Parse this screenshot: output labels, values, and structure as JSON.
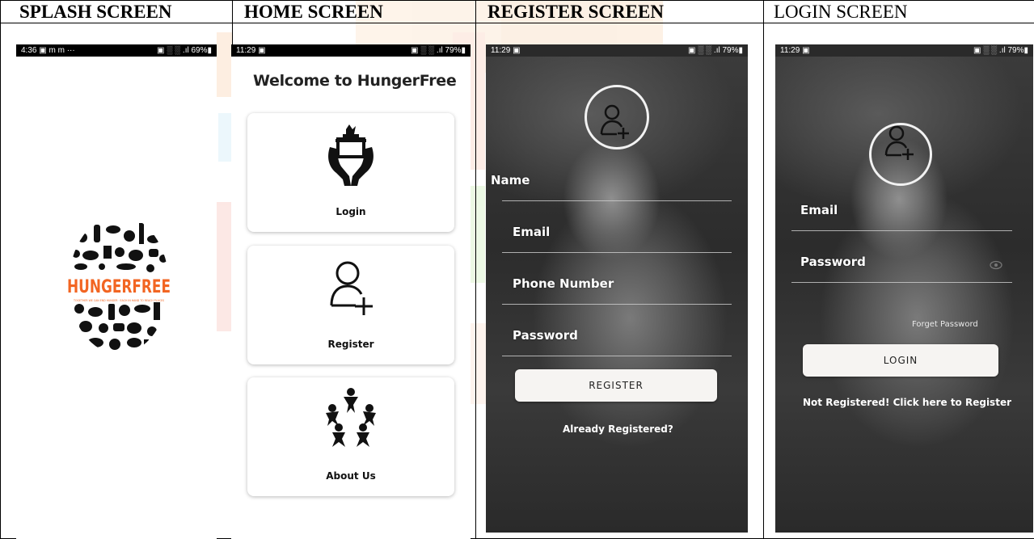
{
  "headers": {
    "splash": "SPLASH SCREEN",
    "home": "HOME SCREEN",
    "register": "REGISTER SCREEN",
    "login": "LOGIN SCREEN"
  },
  "splash": {
    "status": {
      "time": "4:36",
      "left_icons": "▣ m m ···",
      "right": "▣ ░ ░ .ıl 69%▮"
    },
    "logo_text": "HUNGERFREE",
    "logo_tagline": "TOGETHER WE CAN END HUNGER · EACH IN HAND TO REACH PLACES"
  },
  "home": {
    "status": {
      "time": "11:29",
      "left_icons": "▣",
      "right": "▣ ░ ░ .ıl 79%▮"
    },
    "title": "Welcome to HungerFree",
    "cards": [
      {
        "label": "Login",
        "icon": "hands-with-food-icon"
      },
      {
        "label": "Register",
        "icon": "add-user-icon"
      },
      {
        "label": "About Us",
        "icon": "people-circle-icon"
      }
    ]
  },
  "register": {
    "status": {
      "time": "11:29",
      "left_icons": "▣",
      "right": "▣ ░ ░ .ıl 79%▮"
    },
    "fields": [
      "Name",
      "Email",
      "Phone Number",
      "Password"
    ],
    "button": "REGISTER",
    "link": "Already Registered?"
  },
  "login": {
    "status": {
      "time": "11:29",
      "left_icons": "▣",
      "right": "▣ ░ ░ .ıl 79%▮"
    },
    "fields": [
      "Email",
      "Password"
    ],
    "forget": "Forget Password",
    "button": "LOGIN",
    "link": "Not Registered! Click here to Register"
  },
  "colors": {
    "border": "#000000",
    "card_bg": "#ffffff",
    "button_bg": "#f6f4f2",
    "logo_orange": "#f26522"
  }
}
